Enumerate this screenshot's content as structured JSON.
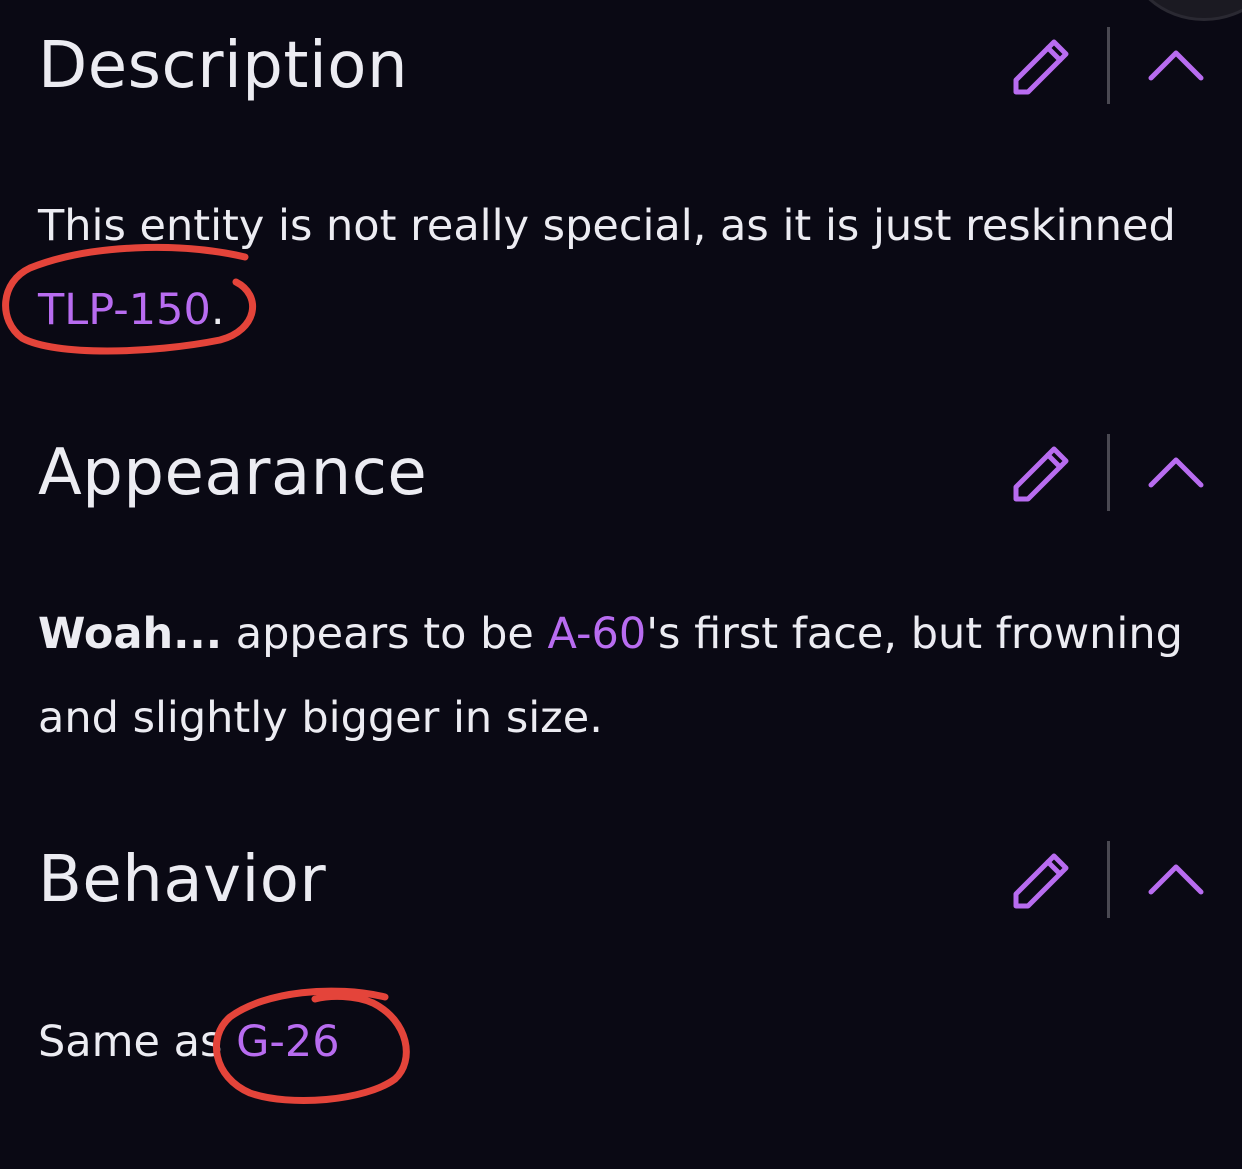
{
  "sections": [
    {
      "title": "Description",
      "body": {
        "text_before": "This entity is not really special, as it is just reskinned ",
        "link": "TLP-150",
        "text_after": "."
      }
    },
    {
      "title": "Appearance",
      "body": {
        "bold": "Woah...",
        "text_before": " appears to be ",
        "link": "A-60",
        "text_after": "'s first face, but frowning and slightly bigger in size."
      }
    },
    {
      "title": "Behavior",
      "body": {
        "text_before": "Same as ",
        "link": "G-26",
        "text_after": ""
      }
    }
  ],
  "icons": {
    "edit": "pencil-icon",
    "collapse": "chevron-up-icon"
  },
  "colors": {
    "background": "#0a0914",
    "text": "#ececf2",
    "accent": "#b86cf0",
    "annotation": "#e4443a"
  }
}
